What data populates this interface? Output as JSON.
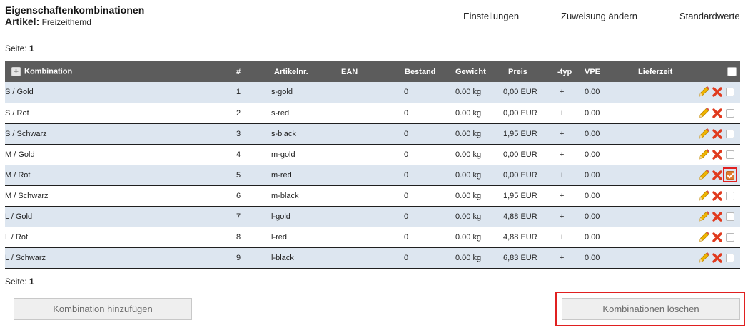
{
  "header": {
    "title": "Eigenschaftenkombinationen",
    "article_label": "Artikel:",
    "article_name": "Freizeithemd"
  },
  "top_links": {
    "settings": "Einstellungen",
    "change_assignment": "Zuweisung ändern",
    "defaults": "Standardwerte"
  },
  "pager_top": {
    "label": "Seite:",
    "page": "1"
  },
  "pager_bottom": {
    "label": "Seite:",
    "page": "1"
  },
  "table": {
    "columns": {
      "combination": "Kombination",
      "number": "#",
      "article_no": "Artikelnr.",
      "ean": "EAN",
      "stock": "Bestand",
      "weight": "Gewicht",
      "price": "Preis",
      "type": "-typ",
      "vpe": "VPE",
      "delivery": "Lieferzeit"
    },
    "rows": [
      {
        "combination": "S  /  Gold",
        "number": "1",
        "article_no": "s-gold",
        "ean": "",
        "stock": "0",
        "weight": "0.00 kg",
        "price": "0,00 EUR",
        "type": "+",
        "vpe": "0.00",
        "delivery": "",
        "checked": false
      },
      {
        "combination": "S  /  Rot",
        "number": "2",
        "article_no": "s-red",
        "ean": "",
        "stock": "0",
        "weight": "0.00 kg",
        "price": "0,00 EUR",
        "type": "+",
        "vpe": "0.00",
        "delivery": "",
        "checked": false
      },
      {
        "combination": "S  /  Schwarz",
        "number": "3",
        "article_no": "s-black",
        "ean": "",
        "stock": "0",
        "weight": "0.00 kg",
        "price": "1,95 EUR",
        "type": "+",
        "vpe": "0.00",
        "delivery": "",
        "checked": false
      },
      {
        "combination": "M  /  Gold",
        "number": "4",
        "article_no": "m-gold",
        "ean": "",
        "stock": "0",
        "weight": "0.00 kg",
        "price": "0,00 EUR",
        "type": "+",
        "vpe": "0.00",
        "delivery": "",
        "checked": false
      },
      {
        "combination": "M  /  Rot",
        "number": "5",
        "article_no": "m-red",
        "ean": "",
        "stock": "0",
        "weight": "0.00 kg",
        "price": "0,00 EUR",
        "type": "+",
        "vpe": "0.00",
        "delivery": "",
        "checked": true
      },
      {
        "combination": "M  /  Schwarz",
        "number": "6",
        "article_no": "m-black",
        "ean": "",
        "stock": "0",
        "weight": "0.00 kg",
        "price": "1,95 EUR",
        "type": "+",
        "vpe": "0.00",
        "delivery": "",
        "checked": false
      },
      {
        "combination": "L  /  Gold",
        "number": "7",
        "article_no": "l-gold",
        "ean": "",
        "stock": "0",
        "weight": "0.00 kg",
        "price": "4,88 EUR",
        "type": "+",
        "vpe": "0.00",
        "delivery": "",
        "checked": false
      },
      {
        "combination": "L  /  Rot",
        "number": "8",
        "article_no": "l-red",
        "ean": "",
        "stock": "0",
        "weight": "0.00 kg",
        "price": "4,88 EUR",
        "type": "+",
        "vpe": "0.00",
        "delivery": "",
        "checked": false
      },
      {
        "combination": "L  /  Schwarz",
        "number": "9",
        "article_no": "l-black",
        "ean": "",
        "stock": "0",
        "weight": "0.00 kg",
        "price": "6,83 EUR",
        "type": "+",
        "vpe": "0.00",
        "delivery": "",
        "checked": false
      }
    ]
  },
  "buttons": {
    "add_combination": "Kombination hinzufügen",
    "delete_combinations": "Kombinationen löschen"
  },
  "icons": {
    "add": "plus-box-icon",
    "edit": "pencil-icon",
    "delete": "red-x-icon",
    "select": "checkbox-icon"
  },
  "colors": {
    "header_bg": "#5c5c5c",
    "row_alt": "#dde6f0",
    "checked": "#e07b2e",
    "highlight": "#e02020",
    "delete_icon": "#e03a1e",
    "edit_icon": "#f0b400"
  }
}
